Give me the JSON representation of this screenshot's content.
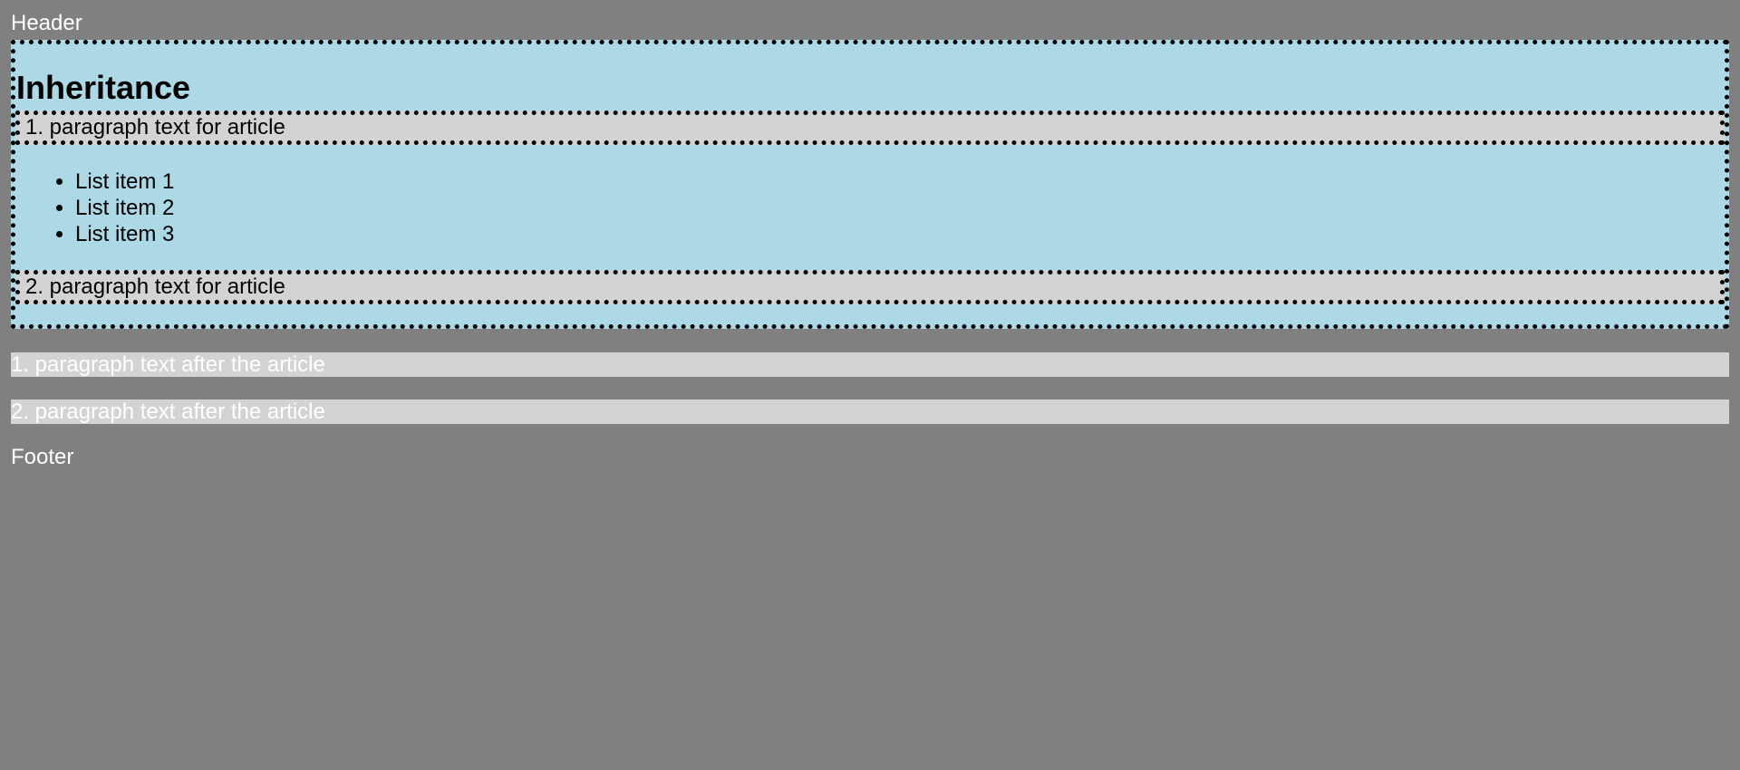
{
  "header": {
    "text": "Header"
  },
  "article": {
    "title": "Inheritance",
    "paragraph_1": "1. paragraph text for article",
    "list_items": [
      "List item 1",
      "List item 2",
      "List item 3"
    ],
    "paragraph_2": "2. paragraph text for article"
  },
  "after_article": [
    "1. paragraph text after the article",
    "2. paragraph text after the article"
  ],
  "footer": {
    "text": "Footer"
  },
  "colors": {
    "page_background": "#808080",
    "article_background": "#add8e6",
    "paragraph_background": "#d3d3d3",
    "border": "#000000",
    "outer_text": "#ffffff",
    "article_text": "#000000"
  }
}
